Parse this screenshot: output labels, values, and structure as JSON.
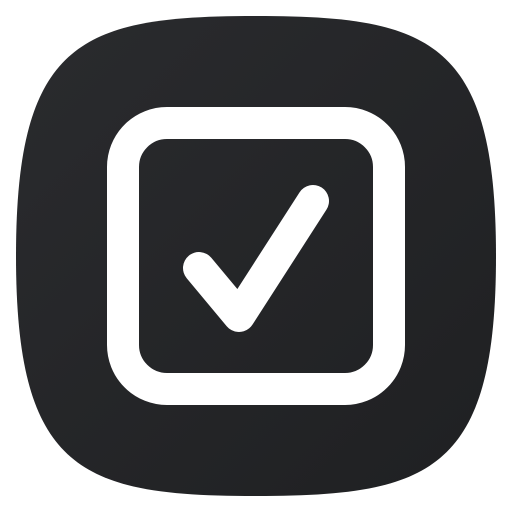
{
  "icon": {
    "name": "checkbox-checked-icon",
    "tile_color": "#1f2022",
    "tile_color_highlight": "#2a2b2e",
    "glyph_color": "#ffffff",
    "checked": true
  }
}
